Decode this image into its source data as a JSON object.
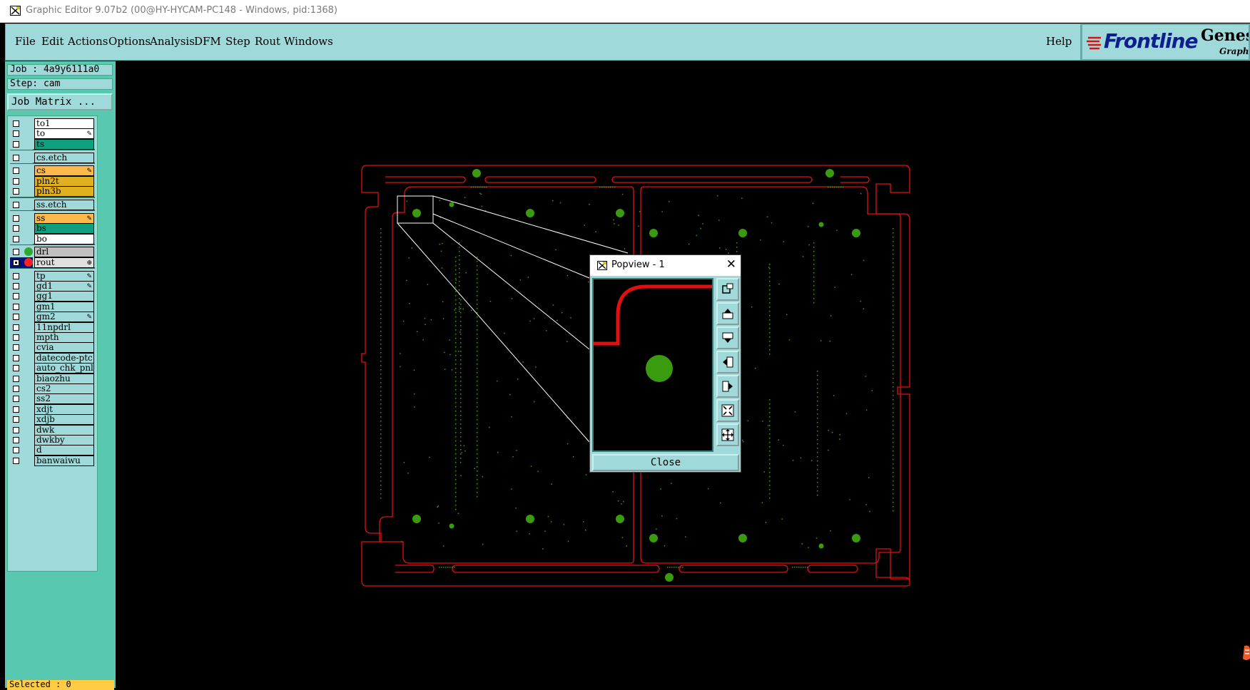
{
  "window": {
    "title": "Graphic Editor 9.07b2 (00@HY-HYCAM-PC148 - Windows, pid:1368)"
  },
  "menu": {
    "items": [
      "File",
      "Edit",
      "Actions",
      "Options",
      "Analysis",
      "DFM",
      "Step",
      "Rout",
      "Windows"
    ],
    "help": "Help"
  },
  "logo": {
    "brand": "Frontline",
    "product": "Genesis",
    "sub": "Graphic"
  },
  "job": {
    "job": "Job : 4a9y6111a0",
    "step": "Step: cam",
    "matrix_button": "Job Matrix ..."
  },
  "layers": [
    {
      "name": "to1",
      "color": "#ffffff"
    },
    {
      "name": "to",
      "color": "#ffffff",
      "mark": "✎"
    },
    {
      "name": "ts",
      "color": "#10a080"
    },
    {
      "name": "cs.etch",
      "color": "#9fd9d9"
    },
    {
      "name": "cs",
      "color": "#ffb84a",
      "mark": "✎"
    },
    {
      "name": "pln2t",
      "color": "#e0b020"
    },
    {
      "name": "pln3b",
      "color": "#e0b020"
    },
    {
      "name": "ss.etch",
      "color": "#9fd9d9"
    },
    {
      "name": "ss",
      "color": "#ffb84a",
      "mark": "✎"
    },
    {
      "name": "bs",
      "color": "#10a080"
    },
    {
      "name": "bo",
      "color": "#ffffff"
    },
    {
      "name": "drl",
      "color": "#c0c0c0",
      "dot": "#2ea82e"
    },
    {
      "name": "rout",
      "color": "#e0e0e0",
      "dot": "#ff2020",
      "selected": true,
      "mark": "⊕"
    },
    {
      "name": "tp",
      "color": "#9fd9d9",
      "mark": "✎"
    },
    {
      "name": "gd1",
      "color": "#9fd9d9",
      "mark": "✎"
    },
    {
      "name": "gg1",
      "color": "#9fd9d9"
    },
    {
      "name": "gm1",
      "color": "#9fd9d9"
    },
    {
      "name": "gm2",
      "color": "#9fd9d9",
      "mark": "✎"
    },
    {
      "name": "11npdrl",
      "color": "#9fd9d9"
    },
    {
      "name": "mpth",
      "color": "#9fd9d9"
    },
    {
      "name": "cvia",
      "color": "#9fd9d9"
    },
    {
      "name": "datecode-ptc",
      "color": "#9fd9d9"
    },
    {
      "name": "auto_chk_pnl",
      "color": "#9fd9d9"
    },
    {
      "name": "biaozhu",
      "color": "#9fd9d9"
    },
    {
      "name": "cs2",
      "color": "#9fd9d9"
    },
    {
      "name": "ss2",
      "color": "#9fd9d9"
    },
    {
      "name": "xdjt",
      "color": "#9fd9d9"
    },
    {
      "name": "xdjb",
      "color": "#9fd9d9"
    },
    {
      "name": "dwk",
      "color": "#9fd9d9"
    },
    {
      "name": "dwkby",
      "color": "#9fd9d9"
    },
    {
      "name": "d",
      "color": "#9fd9d9"
    },
    {
      "name": "banwaiwu",
      "color": "#9fd9d9"
    }
  ],
  "status": {
    "selected": "Selected : 0"
  },
  "popview": {
    "title": "Popview - 1",
    "close_label": "Close"
  },
  "colors": {
    "outline": "#e01010",
    "feature": "#3a9a10",
    "panel": "#9fd9d9"
  }
}
